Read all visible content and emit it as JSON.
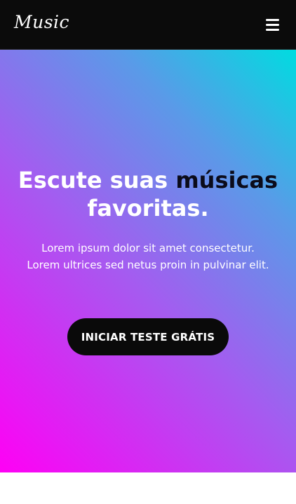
{
  "navbar": {
    "logo": "Music",
    "menu_icon": "hamburger-menu-icon"
  },
  "hero": {
    "headline_part1": "Escute suas",
    "headline_accent": "músicas",
    "headline_part2": "favoritas.",
    "lead_line1": "Lorem ipsum dolor sit amet consectetur.",
    "lead_line2": "Lorem ultrices sed netus proin in pulvinar elit.",
    "cta_label": "INICIAR TESTE GRÁTIS"
  },
  "colors": {
    "navbar_bg": "#0b0b0b",
    "gradient_start": "#ff00f5",
    "gradient_end": "#00dce0",
    "accent_text": "#0b0b1a",
    "cta_bg": "#0a0a0a"
  }
}
